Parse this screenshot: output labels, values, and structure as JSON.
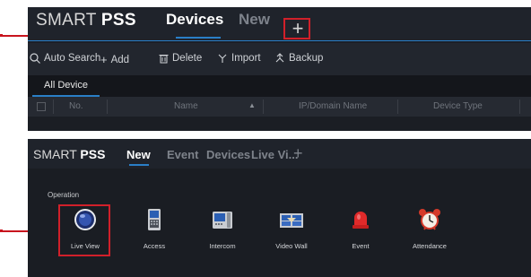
{
  "panel1": {
    "brand_light": "SMART",
    "brand_bold": "PSS",
    "tabs": [
      {
        "label": "Devices",
        "active": true
      },
      {
        "label": "New",
        "active": false
      }
    ],
    "add_tab_symbol": "+",
    "toolbar": {
      "auto_search": "Auto Search",
      "add": "Add",
      "delete": "Delete",
      "import": "Import",
      "backup": "Backup"
    },
    "subtab": "All Device",
    "table": {
      "columns": [
        "No.",
        "Name",
        "IP/Domain Name",
        "Device Type"
      ]
    }
  },
  "panel2": {
    "brand_light": "SMART",
    "brand_bold": "PSS",
    "tabs": [
      {
        "label": "New",
        "active": true
      },
      {
        "label": "Event",
        "active": false
      },
      {
        "label": "Devices",
        "active": false
      },
      {
        "label": "Live Vi...",
        "active": false
      }
    ],
    "add_tab_symbol": "+",
    "section_title": "Operation",
    "apps": [
      {
        "label": "Live View",
        "icon": "live-view-icon"
      },
      {
        "label": "Access",
        "icon": "access-icon"
      },
      {
        "label": "Intercom",
        "icon": "intercom-icon"
      },
      {
        "label": "Video Wall",
        "icon": "video-wall-icon"
      },
      {
        "label": "Event",
        "icon": "event-icon"
      },
      {
        "label": "Attendance",
        "icon": "attendance-icon"
      }
    ]
  },
  "colors": {
    "accent": "#2a7fc7",
    "highlight": "#d1202a",
    "background": "#1c1f26"
  }
}
